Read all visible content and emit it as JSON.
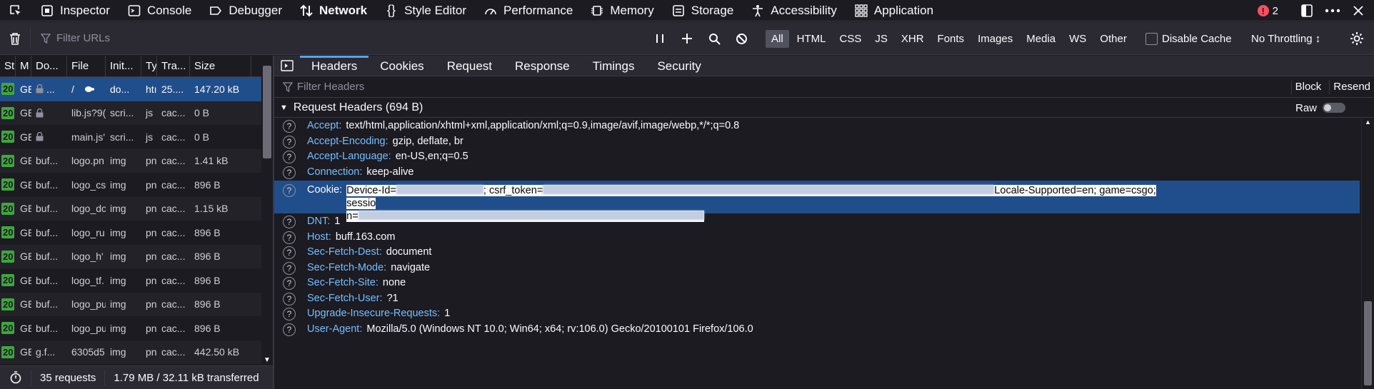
{
  "toolbox": {
    "tabs": [
      {
        "label": "Inspector",
        "icon": "inspector-icon"
      },
      {
        "label": "Console",
        "icon": "console-icon"
      },
      {
        "label": "Debugger",
        "icon": "debugger-icon"
      },
      {
        "label": "Network",
        "icon": "network-icon",
        "active": true
      },
      {
        "label": "Style Editor",
        "icon": "style-editor-icon"
      },
      {
        "label": "Performance",
        "icon": "performance-icon"
      },
      {
        "label": "Memory",
        "icon": "memory-icon"
      },
      {
        "label": "Storage",
        "icon": "storage-icon"
      },
      {
        "label": "Accessibility",
        "icon": "accessibility-icon"
      },
      {
        "label": "Application",
        "icon": "application-icon"
      }
    ],
    "error_count": "2"
  },
  "net_toolbar": {
    "filter_placeholder": "Filter URLs",
    "types": [
      "All",
      "HTML",
      "CSS",
      "JS",
      "XHR",
      "Fonts",
      "Images",
      "Media",
      "WS",
      "Other"
    ],
    "active_type": "All",
    "disable_cache_label": "Disable Cache",
    "throttling_label": "No Throttling ↕"
  },
  "request_list": {
    "columns": [
      "St",
      "M",
      "Do...",
      "File",
      "Init...",
      "Ty",
      "Tra...",
      "Size"
    ],
    "rows": [
      {
        "status": "20",
        "method": "GE",
        "domain": "...",
        "file": "/",
        "initiator": "do...",
        "type": "htı",
        "transferred": "25....",
        "size": "147.20 kB",
        "lock": true,
        "selected": true
      },
      {
        "status": "20",
        "method": "GE",
        "domain": "",
        "file": "lib.js?9(",
        "initiator": "scri...",
        "type": "js",
        "transferred": "cac...",
        "size": "0 B",
        "lock": true
      },
      {
        "status": "20",
        "method": "GE",
        "domain": "",
        "file": "main.js'",
        "initiator": "scri...",
        "type": "js",
        "transferred": "cac...",
        "size": "0 B",
        "lock": true
      },
      {
        "status": "20",
        "method": "GE",
        "domain": "buf...",
        "file": "logo.pn",
        "initiator": "img",
        "type": "pn",
        "transferred": "cac...",
        "size": "1.41 kB"
      },
      {
        "status": "20",
        "method": "GE",
        "domain": "buf...",
        "file": "logo_cs",
        "initiator": "img",
        "type": "pn",
        "transferred": "cac...",
        "size": "896 B"
      },
      {
        "status": "20",
        "method": "GE",
        "domain": "buf...",
        "file": "logo_dc",
        "initiator": "img",
        "type": "pn",
        "transferred": "cac...",
        "size": "1.15 kB"
      },
      {
        "status": "20",
        "method": "GE",
        "domain": "buf...",
        "file": "logo_ru",
        "initiator": "img",
        "type": "pn",
        "transferred": "cac...",
        "size": "896 B"
      },
      {
        "status": "20",
        "method": "GE",
        "domain": "buf...",
        "file": "logo_h'",
        "initiator": "img",
        "type": "pn",
        "transferred": "cac...",
        "size": "896 B"
      },
      {
        "status": "20",
        "method": "GE",
        "domain": "buf...",
        "file": "logo_tf.",
        "initiator": "img",
        "type": "pn",
        "transferred": "cac...",
        "size": "896 B"
      },
      {
        "status": "20",
        "method": "GE",
        "domain": "buf...",
        "file": "logo_pu",
        "initiator": "img",
        "type": "pn",
        "transferred": "cac...",
        "size": "896 B"
      },
      {
        "status": "20",
        "method": "GE",
        "domain": "buf...",
        "file": "logo_pu",
        "initiator": "img",
        "type": "pn",
        "transferred": "cac...",
        "size": "896 B"
      },
      {
        "status": "20",
        "method": "GE",
        "domain": "g.f...",
        "file": "6305d5",
        "initiator": "img",
        "type": "pn",
        "transferred": "cac...",
        "size": "442.50 kB"
      }
    ]
  },
  "status_bar": {
    "requests": "35 requests",
    "transferred": "1.79 MB / 32.11 kB transferred"
  },
  "details": {
    "tabs": [
      "Headers",
      "Cookies",
      "Request",
      "Response",
      "Timings",
      "Security"
    ],
    "active_tab": "Headers",
    "filter_placeholder": "Filter Headers",
    "block_label": "Block",
    "resend_label": "Resend",
    "section_title": "Request Headers (694 B)",
    "raw_label": "Raw",
    "headers": [
      {
        "name": "Accept:",
        "value": "text/html,application/xhtml+xml,application/xml;q=0.9,image/avif,image/webp,*/*;q=0.8"
      },
      {
        "name": "Accept-Encoding:",
        "value": "gzip, deflate, br"
      },
      {
        "name": "Accept-Language:",
        "value": "en-US,en;q=0.5"
      },
      {
        "name": "Connection:",
        "value": "keep-alive"
      }
    ],
    "cookie": {
      "name": "Cookie:",
      "part1": "Device-Id=",
      "part2": "; csrf_token=",
      "part3": "Locale-Supported=en; game=csgo; sessio",
      "part4": "n="
    },
    "headers2": [
      {
        "name": "DNT:",
        "value": "1"
      },
      {
        "name": "Host:",
        "value": "buff.163.com"
      },
      {
        "name": "Sec-Fetch-Dest:",
        "value": "document"
      },
      {
        "name": "Sec-Fetch-Mode:",
        "value": "navigate"
      },
      {
        "name": "Sec-Fetch-Site:",
        "value": "none"
      },
      {
        "name": "Sec-Fetch-User:",
        "value": "?1"
      },
      {
        "name": "Upgrade-Insecure-Requests:",
        "value": "1"
      },
      {
        "name": "User-Agent:",
        "value": "Mozilla/5.0 (Windows NT 10.0; Win64; x64; rv:106.0) Gecko/20100101 Firefox/106.0"
      }
    ]
  }
}
